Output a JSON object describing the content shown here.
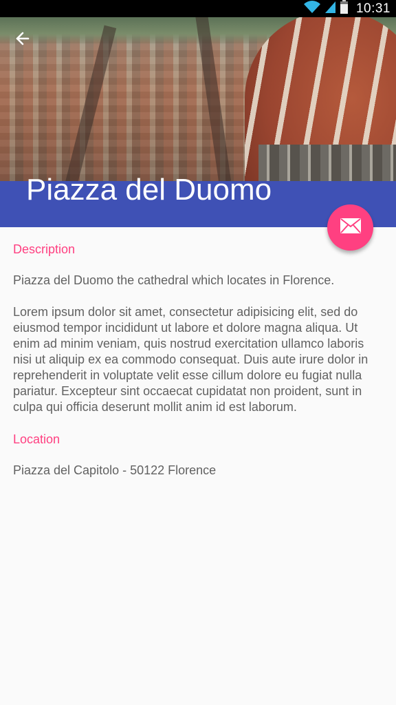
{
  "status_bar": {
    "time": "10:31",
    "icons": [
      "wifi-icon",
      "signal-icon",
      "battery-icon"
    ]
  },
  "header": {
    "title": "Piazza del Duomo",
    "back_icon": "arrow-back-icon",
    "image": "florence-aerial-photo"
  },
  "fab": {
    "icon": "email-icon",
    "color": "#ff4081"
  },
  "colors": {
    "primary": "#3f51b5",
    "accent": "#ff4081",
    "text": "#616161"
  },
  "description": {
    "label": "Description",
    "intro": "Piazza del Duomo the cathedral which locates in Florence.",
    "body": "Lorem ipsum dolor sit amet, consectetur adipisicing elit, sed do eiusmod tempor incididunt ut labore et dolore magna aliqua. Ut enim ad minim veniam, quis nostrud exercitation ullamco laboris nisi ut aliquip ex ea commodo consequat. Duis aute irure dolor in reprehenderit in voluptate velit esse cillum dolore eu fugiat nulla pariatur. Excepteur sint occaecat cupidatat non proident, sunt in culpa qui officia deserunt mollit anim id est laborum."
  },
  "location": {
    "label": "Location",
    "address": "Piazza del Capitolo - 50122 Florence"
  }
}
